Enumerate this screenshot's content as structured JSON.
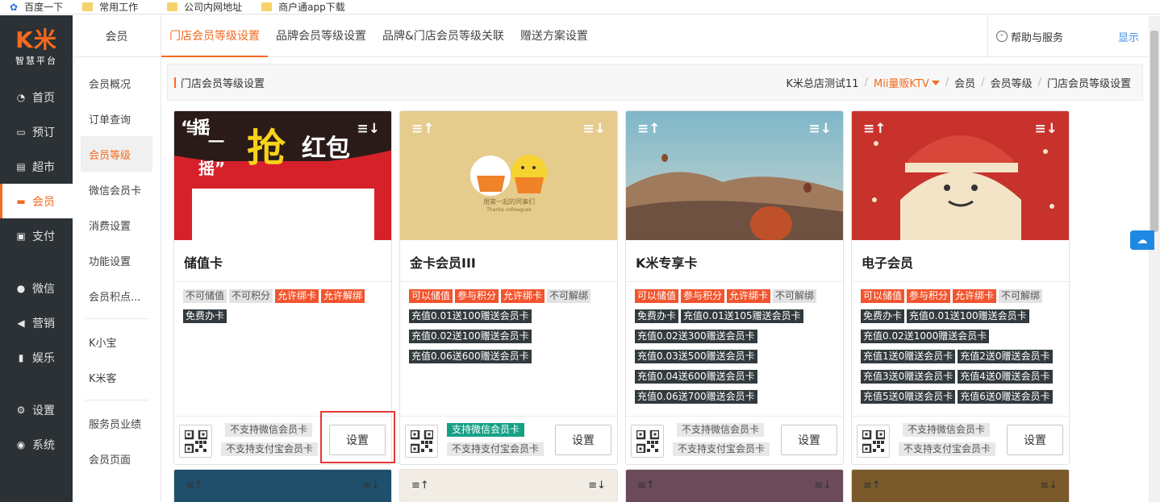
{
  "bookmarks": [
    {
      "label": "百度一下",
      "icon": "paw-icon"
    },
    {
      "label": "常用工作",
      "icon": "folder-icon"
    },
    {
      "label": "公司内网地址",
      "icon": "folder-icon"
    },
    {
      "label": "商户通app下载",
      "icon": "folder-icon"
    }
  ],
  "brand": {
    "logo": "K米",
    "tagline": "智慧平台"
  },
  "nav": [
    {
      "label": "首页",
      "icon": "dashboard-icon"
    },
    {
      "label": "预订",
      "icon": "sofa-icon"
    },
    {
      "label": "超市",
      "icon": "basket-icon"
    },
    {
      "label": "会员",
      "icon": "card-icon"
    },
    {
      "label": "支付",
      "icon": "money-icon"
    },
    {
      "label": "微信",
      "icon": "wechat-icon"
    },
    {
      "label": "营销",
      "icon": "megaphone-icon"
    },
    {
      "label": "娱乐",
      "icon": "bottle-icon"
    },
    {
      "label": "设置",
      "icon": "gear-icon"
    },
    {
      "label": "系统",
      "icon": "chrome-icon"
    }
  ],
  "sub": {
    "header": "会员",
    "items": [
      "会员概况",
      "订单查询",
      "会员等级",
      "微信会员卡",
      "消费设置",
      "功能设置",
      "会员积点...",
      "K小宝",
      "K米客",
      "服务员业绩",
      "会员页面"
    ]
  },
  "tabs": [
    "门店会员等级设置",
    "品牌会员等级设置",
    "品牌&门店会员等级关联",
    "赠送方案设置"
  ],
  "help": {
    "label": "帮助与服务",
    "show": "显示"
  },
  "breadcrumb": {
    "title": "门店会员等级设置",
    "company": "K米总店测试11",
    "store": "Mii量贩KTV",
    "path": [
      "会员",
      "会员等级",
      "门店会员等级设置"
    ]
  },
  "cards": [
    {
      "name": "储值卡",
      "tags": [
        [
          "不可储值",
          "gray"
        ],
        [
          "不可积分",
          "gray"
        ],
        [
          "允许绑卡",
          "orange"
        ],
        [
          "允许解绑",
          "orange"
        ],
        [
          "免费办卡",
          "dark"
        ]
      ],
      "wechat": "不支持微信会员卡",
      "wechat_on": false,
      "alipay": "不支持支付宝会员卡",
      "button": "设置"
    },
    {
      "name": "金卡会员III",
      "tags": [
        [
          "可以储值",
          "orange"
        ],
        [
          "参与积分",
          "orange"
        ],
        [
          "允许绑卡",
          "orange"
        ],
        [
          "不可解绑",
          "gray"
        ],
        [
          "充值0.01送100赠送会员卡",
          "dark"
        ],
        [
          "充值0.02送100赠送会员卡",
          "dark"
        ],
        [
          "充值0.06送600赠送会员卡",
          "dark"
        ]
      ],
      "wechat": "支持微信会员卡",
      "wechat_on": true,
      "alipay": "不支持支付宝会员卡",
      "button": "设置"
    },
    {
      "name": "K米专享卡",
      "tags": [
        [
          "可以储值",
          "orange"
        ],
        [
          "参与积分",
          "orange"
        ],
        [
          "允许绑卡",
          "orange"
        ],
        [
          "不可解绑",
          "gray"
        ],
        [
          "免费办卡",
          "dark"
        ],
        [
          "充值0.01送105赠送会员卡",
          "dark"
        ],
        [
          "充值0.02送300赠送会员卡",
          "dark"
        ],
        [
          "充值0.03送500赠送会员卡",
          "dark"
        ],
        [
          "充值0.04送600赠送会员卡",
          "dark"
        ],
        [
          "充值0.06送700赠送会员卡",
          "dark"
        ]
      ],
      "wechat": "不支持微信会员卡",
      "wechat_on": false,
      "alipay": "不支持支付宝会员卡",
      "button": "设置"
    },
    {
      "name": "电子会员",
      "tags": [
        [
          "可以储值",
          "orange"
        ],
        [
          "参与积分",
          "orange"
        ],
        [
          "允许绑卡",
          "orange"
        ],
        [
          "不可解绑",
          "gray"
        ],
        [
          "免费办卡",
          "dark"
        ],
        [
          "充值0.01送100赠送会员卡",
          "dark"
        ],
        [
          "充值0.02送1000赠送会员卡",
          "dark"
        ],
        [
          "充值1送0赠送会员卡",
          "dark"
        ],
        [
          "充值2送0赠送会员卡",
          "dark"
        ],
        [
          "充值3送0赠送会员卡",
          "dark"
        ],
        [
          "充值4送0赠送会员卡",
          "dark"
        ],
        [
          "充值5送0赠送会员卡",
          "dark"
        ],
        [
          "充值6送0赠送会员卡",
          "dark"
        ]
      ],
      "wechat": "不支持微信会员卡",
      "wechat_on": false,
      "alipay": "不支持支付宝会员卡",
      "button": "设置"
    }
  ],
  "card_images": {
    "card1": {
      "line1": "“摇",
      "line2": "一",
      "line3": "摇”",
      "grab": "抢",
      "redpack": "红包"
    },
    "card2": {
      "caption": "朋第一起的同事们",
      "caption_en": "Thanks colleagues"
    }
  },
  "sort_icons": {
    "up": "≡↑",
    "down": "≡↓"
  },
  "colors": {
    "accent": "#f46a1e",
    "sidebar": "#2b3135",
    "tag_orange": "#f2542d",
    "tag_dark": "#333a3e",
    "wechat_on": "#16a085"
  }
}
